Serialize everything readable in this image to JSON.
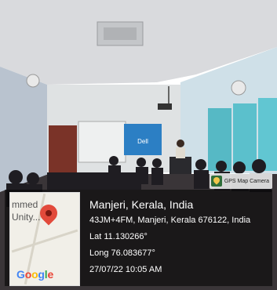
{
  "badge": {
    "label": "GPS Map Camera",
    "icon": "gps-map-camera-icon"
  },
  "map": {
    "label_line1": "mmed",
    "label_line2": "Unity...",
    "logo": "Google",
    "logo_colors": [
      "#4285F4",
      "#EA4335",
      "#FBBC05",
      "#4285F4",
      "#34A853",
      "#EA4335"
    ]
  },
  "location": {
    "city": "Manjeri, Kerala, India",
    "address": "43JM+4FM, Manjeri, Kerala 676122, India",
    "latitude": "Lat 11.130266°",
    "longitude": "Long 76.083677°",
    "datetime": "27/07/22 10:05 AM"
  },
  "projector": {
    "slide_text": "Dell"
  }
}
